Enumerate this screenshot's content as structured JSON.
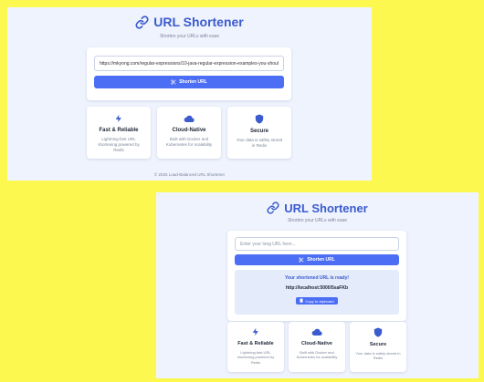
{
  "app": {
    "title": "URL Shortener",
    "subtitle": "Shorten your URLs with ease",
    "shorten_button": "Shorten URL",
    "input_placeholder": "Enter your long URL here...",
    "features": [
      {
        "icon": "lightning-bolt-icon",
        "title": "Fast & Reliable",
        "desc": "Lightning-fast URL shortening powered by Redis"
      },
      {
        "icon": "cloud-icon",
        "title": "Cloud-Native",
        "desc": "Built with Docker and Kubernetes for scalability"
      },
      {
        "icon": "shield-icon",
        "title": "Secure",
        "desc": "Your data is safely stored in Redis"
      }
    ],
    "footer": "© 2025 Load-Balanced URL Shortener"
  },
  "panel_a": {
    "input_value": "https://mkyong.com/regular-expressions/10-java-regular-expression-examples-you-should-know/"
  },
  "panel_b": {
    "input_value": "",
    "result": {
      "label": "Your shortened URL is ready!",
      "short_url": "http://localhost:5000/5saFKb",
      "copy_button": "Copy to clipboard"
    }
  },
  "colors": {
    "background": "#fdf84f",
    "panel": "#eff3fd",
    "accent": "#4c6ef5",
    "title": "#3b5bcf",
    "result_box": "#e4ebfb"
  }
}
